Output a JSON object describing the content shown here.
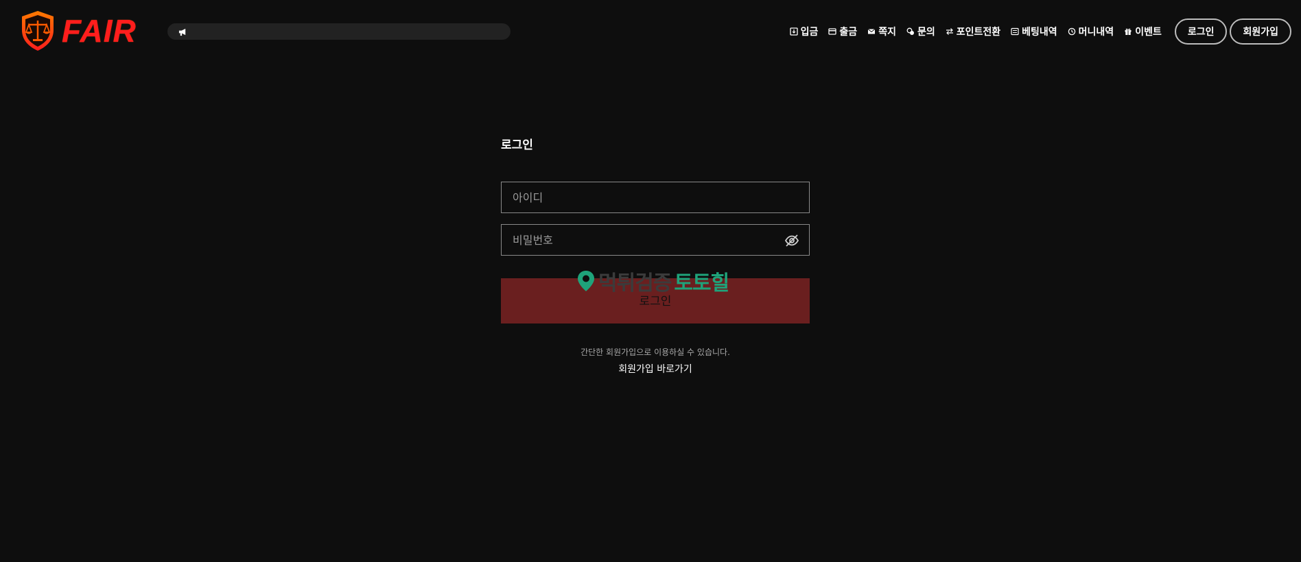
{
  "brand": {
    "logo_text": "FAIR",
    "accent": "#ff1d1d",
    "shield_color": "#ff4a00"
  },
  "notice_bar": {
    "icon": "megaphone-icon",
    "text": ""
  },
  "nav": {
    "items": [
      {
        "label": "입금",
        "icon": "deposit-icon"
      },
      {
        "label": "출금",
        "icon": "withdraw-icon"
      },
      {
        "label": "쪽지",
        "icon": "mail-icon"
      },
      {
        "label": "문의",
        "icon": "inquiry-icon"
      },
      {
        "label": "포인트전환",
        "icon": "exchange-icon"
      },
      {
        "label": "베팅내역",
        "icon": "list-icon"
      },
      {
        "label": "머니내역",
        "icon": "clock-icon"
      },
      {
        "label": "이벤트",
        "icon": "gift-icon"
      }
    ],
    "login_label": "로그인",
    "signup_label": "회원가입"
  },
  "login_form": {
    "title": "로그인",
    "id_placeholder": "아이디",
    "password_placeholder": "비밀번호",
    "password_toggle_icon": "eye-off-icon",
    "submit_label": "로그인",
    "submit_color": "#6a1f1f",
    "signup_hint": "간단한 회원가입으로 이용하실 수 있습니다.",
    "signup_link": "회원가입 바로가기"
  },
  "watermark": {
    "text_a": "먹튀검증",
    "text_b": "토토힐",
    "icon": "location-pin-icon",
    "color": "#1fa37a"
  }
}
